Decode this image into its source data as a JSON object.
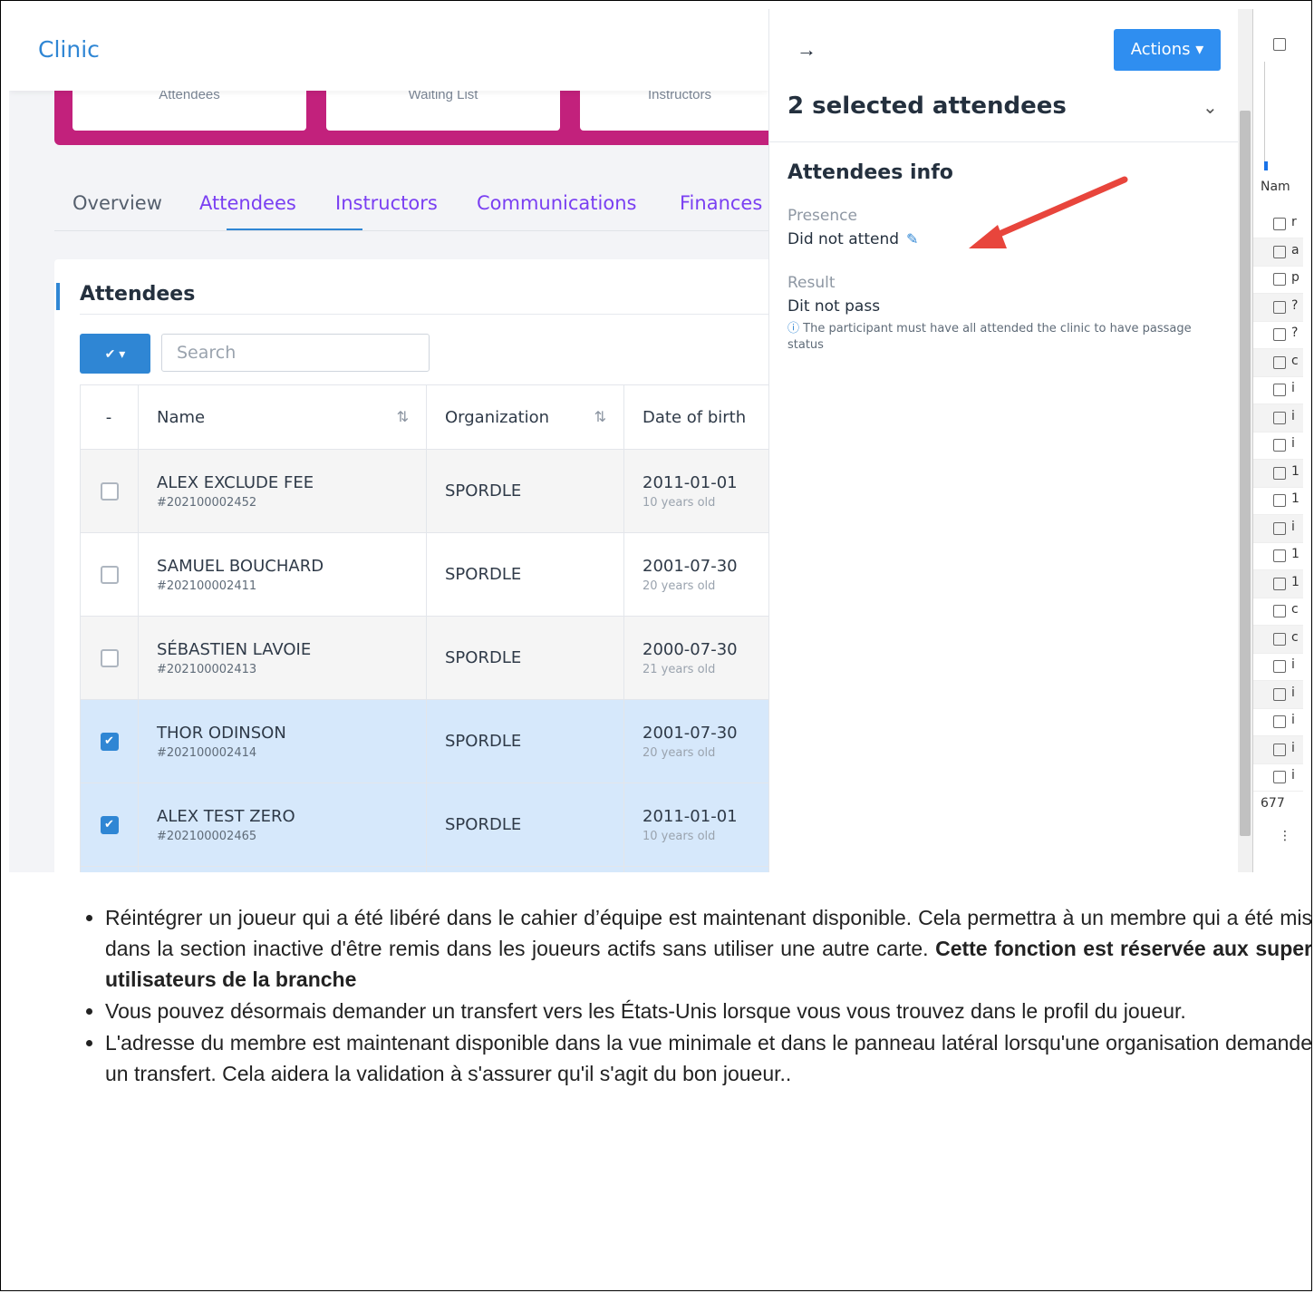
{
  "app": {
    "brand": "Clinic",
    "hero_cards": [
      "Attendees",
      "Waiting List",
      "Instructors"
    ],
    "tabs": [
      "Overview",
      "Attendees",
      "Instructors",
      "Communications",
      "Finances"
    ],
    "active_tab": "Attendees",
    "card_title": "Attendees",
    "search_placeholder": "Search",
    "bulk_check_label": "✔ ▾",
    "columns": [
      "-",
      "Name",
      "Organization",
      "Date of birth"
    ],
    "rows": [
      {
        "name": "ALEX EXCLUDE FEE",
        "id": "#202100002452",
        "org": "SPORDLE",
        "dob": "2011-01-01",
        "age": "10 years old",
        "checked": false
      },
      {
        "name": "SAMUEL BOUCHARD",
        "id": "#202100002411",
        "org": "SPORDLE",
        "dob": "2001-07-30",
        "age": "20 years old",
        "checked": false
      },
      {
        "name": "SÉBASTIEN LAVOIE",
        "id": "#202100002413",
        "org": "SPORDLE",
        "dob": "2000-07-30",
        "age": "21 years old",
        "checked": false
      },
      {
        "name": "THOR ODINSON",
        "id": "#202100002414",
        "org": "SPORDLE",
        "dob": "2001-07-30",
        "age": "20 years old",
        "checked": true
      },
      {
        "name": "ALEX TEST ZERO",
        "id": "#202100002465",
        "org": "SPORDLE",
        "dob": "2011-01-01",
        "age": "10 years old",
        "checked": true
      }
    ]
  },
  "panel": {
    "back_arrow": "→",
    "actions_label": "Actions ▾",
    "title": "2 selected attendees",
    "section_title": "Attendees info",
    "presence_label": "Presence",
    "presence_value": "Did not attend",
    "result_label": "Result",
    "result_value": "Dit not pass",
    "note": "The participant must have all attended the clinic to have passage status"
  },
  "devtools": {
    "name_header": "Nam",
    "count_text": "677",
    "row_letters": [
      "r",
      "a",
      "p",
      "?",
      "?",
      "c",
      "i",
      "i",
      "i",
      "1",
      "1",
      "i",
      "1",
      "1",
      "c",
      "c",
      "i",
      "i",
      "i",
      "i",
      "i"
    ]
  },
  "notes": {
    "item1_text": "Réintégrer un joueur qui a été libéré dans le cahier d’équipe est maintenant disponible.  Cela permettra à un membre qui a été mis dans la section inactive d'être remis dans les joueurs actifs sans utiliser une autre carte. ",
    "item1_bold": "Cette fonction est réservée aux super utilisateurs de la branche",
    "item2": "Vous pouvez désormais demander un transfert vers les États-Unis lorsque vous vous trouvez dans le profil du joueur.",
    "item3": "L'adresse du membre est maintenant disponible dans la vue minimale et dans le panneau latéral lorsqu'une organisation demande un transfert.   Cela aidera la validation à s'assurer qu'il s'agit du bon joueur.."
  },
  "colors": {
    "primary": "#2f86d4",
    "hero": "#c2217c",
    "tab_text": "#7a3ff2",
    "arrow": "#e8453c",
    "selected_row": "#d6e8fb"
  }
}
